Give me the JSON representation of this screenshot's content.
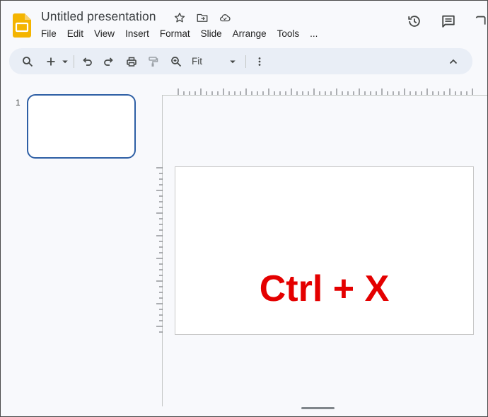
{
  "app": {
    "title": "Untitled presentation",
    "brand_color": "#f4b400"
  },
  "title_icons": [
    "star-icon",
    "move-to-folder-icon",
    "cloud-saved-icon"
  ],
  "menu": {
    "items": [
      "File",
      "Edit",
      "View",
      "Insert",
      "Format",
      "Slide",
      "Arrange",
      "Tools",
      "..."
    ]
  },
  "header_actions": [
    "version-history-icon",
    "comments-icon"
  ],
  "toolbar": {
    "icons": [
      "search-icon",
      "new-slide-icon",
      "dropdown-icon",
      "undo-icon",
      "redo-icon",
      "print-icon",
      "paint-format-icon",
      "zoom-icon",
      "more-icon",
      "collapse-icon"
    ],
    "zoom_value": "Fit"
  },
  "filmstrip": {
    "slides": [
      {
        "number": "1"
      }
    ]
  },
  "slide": {
    "text": "Ctrl + X",
    "text_color": "#e40000"
  }
}
